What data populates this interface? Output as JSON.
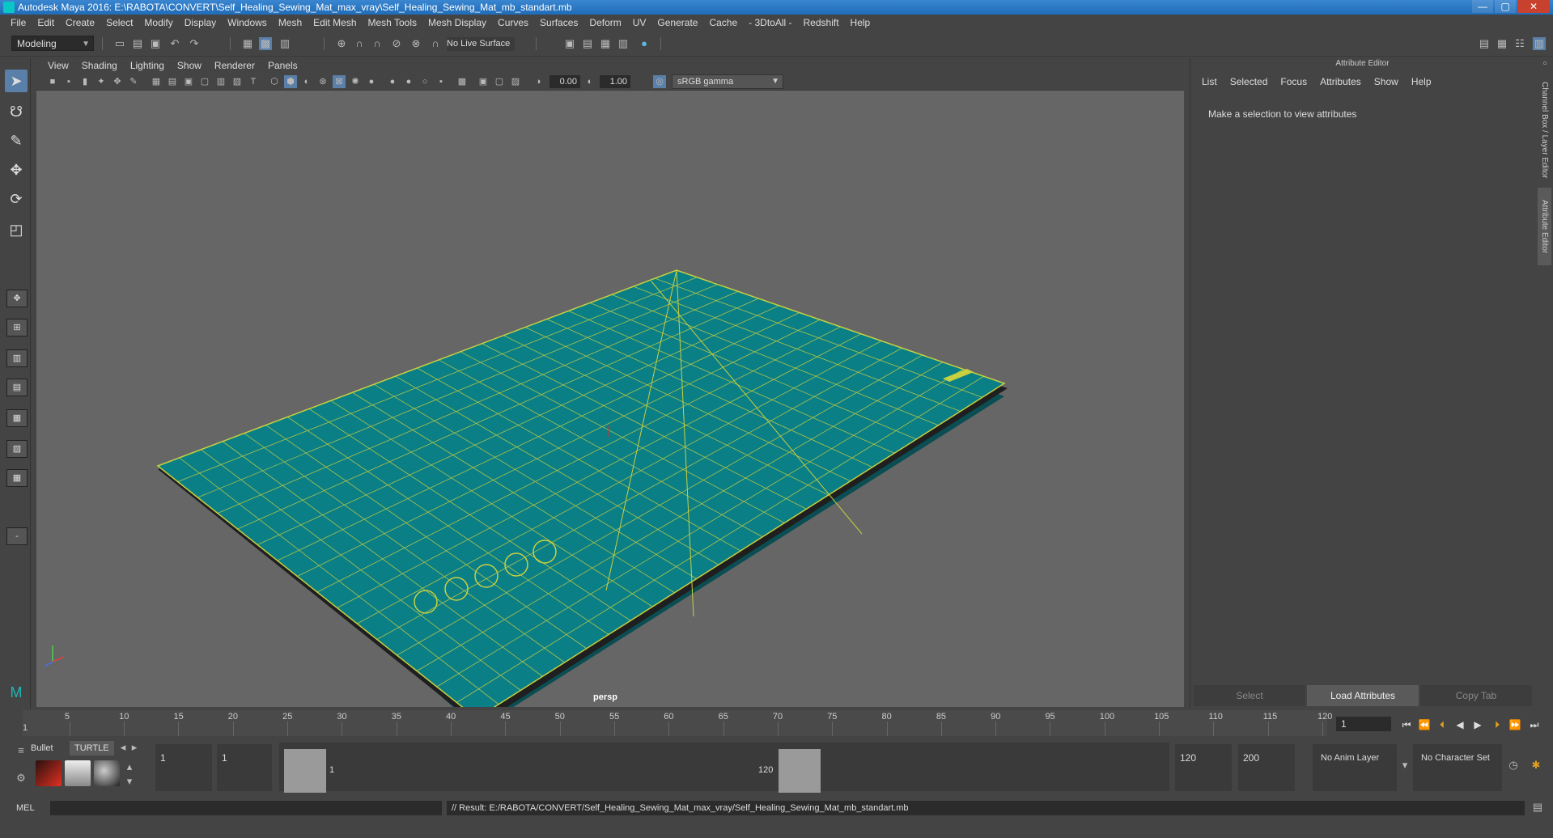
{
  "window": {
    "title": "Autodesk Maya 2016: E:\\RABOTA\\CONVERT\\Self_Healing_Sewing_Mat_max_vray\\Self_Healing_Sewing_Mat_mb_standart.mb",
    "minimize": "—",
    "maximize": "▢",
    "close": "✕"
  },
  "menubar": {
    "items": [
      "File",
      "Edit",
      "Create",
      "Select",
      "Modify",
      "Display",
      "Windows",
      "Mesh",
      "Edit Mesh",
      "Mesh Tools",
      "Mesh Display",
      "Curves",
      "Surfaces",
      "Deform",
      "UV",
      "Generate",
      "Cache",
      "- 3DtoAll -",
      "Redshift",
      "Help"
    ]
  },
  "statusline": {
    "mode": "Modeling",
    "live_surface": "No Live Surface"
  },
  "viewport": {
    "menu": [
      "View",
      "Shading",
      "Lighting",
      "Show",
      "Renderer",
      "Panels"
    ],
    "exposure": "0.00",
    "gamma": "1.00",
    "color_space": "sRGB gamma",
    "camera": "persp",
    "colors": {
      "mat": "#0b7f86",
      "grid": "#c8d040",
      "background": "#666666"
    }
  },
  "attribute_editor": {
    "title": "Attribute Editor",
    "menu": [
      "List",
      "Selected",
      "Focus",
      "Attributes",
      "Show",
      "Help"
    ],
    "hint": "Make a selection to view attributes",
    "buttons": {
      "select": "Select",
      "load": "Load Attributes",
      "copy": "Copy Tab"
    }
  },
  "side_tabs": {
    "channel_box": "Channel Box / Layer Editor",
    "attribute_editor": "Attribute Editor"
  },
  "timeslider": {
    "labels": [
      "5",
      "10",
      "15",
      "20",
      "25",
      "30",
      "35",
      "40",
      "45",
      "50",
      "55",
      "60",
      "65",
      "70",
      "75",
      "80",
      "85",
      "90",
      "95",
      "100",
      "105",
      "110",
      "115",
      "120"
    ],
    "start_label": "1",
    "current_frame": "1"
  },
  "shelf": {
    "tabs": [
      "Bullet",
      "TURTLE"
    ]
  },
  "range": {
    "start": "1",
    "playback_start": "1",
    "range_start_label": "1",
    "range_end_label": "120",
    "playback_end": "120",
    "end": "200",
    "anim_layer": "No Anim Layer",
    "character_set": "No Character Set"
  },
  "cmdline": {
    "language": "MEL",
    "result": "// Result: E:/RABOTA/CONVERT/Self_Healing_Sewing_Mat_max_vray/Self_Healing_Sewing_Mat_mb_standart.mb"
  }
}
